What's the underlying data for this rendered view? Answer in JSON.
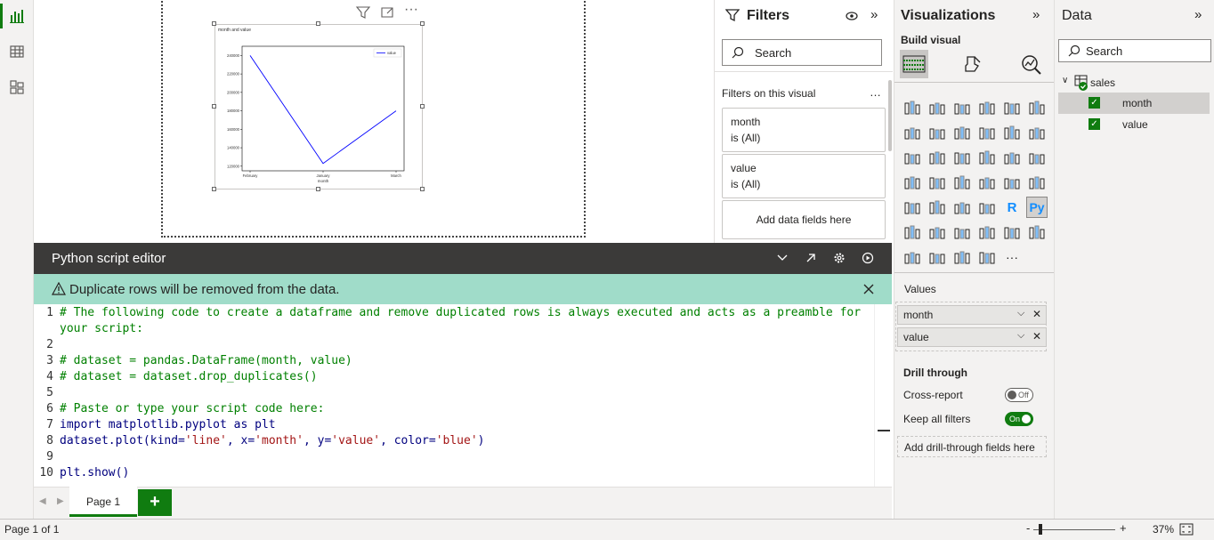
{
  "canvas": {
    "chart_data": {
      "type": "line",
      "title": "month and value",
      "xlabel": "month",
      "categories": [
        "February",
        "January",
        "March"
      ],
      "series": [
        {
          "name": "value",
          "values": [
            240000,
            123000,
            180000
          ]
        }
      ],
      "yticks": [
        "120000",
        "140000",
        "160000",
        "180000",
        "200000",
        "220000",
        "240000"
      ],
      "ylim": [
        115000,
        250000
      ],
      "legend": "top-right",
      "line_color": "#0000ff"
    }
  },
  "filters": {
    "title": "Filters",
    "search_placeholder": "Search",
    "section": "Filters on this visual",
    "cards": [
      {
        "field": "month",
        "state": "is (All)"
      },
      {
        "field": "value",
        "state": "is (All)"
      }
    ],
    "add_fields": "Add data fields here"
  },
  "editor": {
    "title": "Python script editor",
    "warning": "Duplicate rows will be removed from the data.",
    "lines": [
      {
        "n": "1",
        "text": "# The following code to create a dataframe and remove duplicated rows is always executed and acts as a preamble for",
        "cont": "your script:"
      },
      {
        "n": "2",
        "text": ""
      },
      {
        "n": "3",
        "text": "# dataset = pandas.DataFrame(month, value)"
      },
      {
        "n": "4",
        "text": "# dataset = dataset.drop_duplicates()"
      },
      {
        "n": "5",
        "text": ""
      },
      {
        "n": "6",
        "text": "# Paste or type your script code here:"
      },
      {
        "n": "7",
        "text": "import matplotlib.pyplot as plt"
      },
      {
        "n": "8",
        "p1": "dataset.plot(kind=",
        "s1": "'line'",
        "p2": ", x=",
        "s2": "'month'",
        "p3": ", y=",
        "s3": "'value'",
        "p4": ", color=",
        "s4": "'blue'",
        "p5": ")"
      },
      {
        "n": "9",
        "text": ""
      },
      {
        "n": "10",
        "text": "plt.show()"
      }
    ]
  },
  "pages": {
    "tab": "Page 1",
    "add": "+"
  },
  "viz": {
    "title": "Visualizations",
    "build": "Build visual",
    "values_label": "Values",
    "wells": [
      "month",
      "value"
    ],
    "drill": "Drill through",
    "cross_report": "Cross-report",
    "cross_state": "Off",
    "keep_filters": "Keep all filters",
    "keep_state": "On",
    "add_drill": "Add drill-through fields here",
    "r_label": "R",
    "py_label": "Py",
    "more": "···"
  },
  "data": {
    "title": "Data",
    "search_placeholder": "Search",
    "table": "sales",
    "fields": [
      "month",
      "value"
    ]
  },
  "status": {
    "page": "Page 1 of 1",
    "zoom": "37%",
    "minus": "-",
    "plus": "+"
  },
  "colors": {
    "accent_green": "#107c10",
    "warning_bg": "#a0dcc9",
    "header_bg": "#3b3a39",
    "viz_blue": "#118dff"
  }
}
